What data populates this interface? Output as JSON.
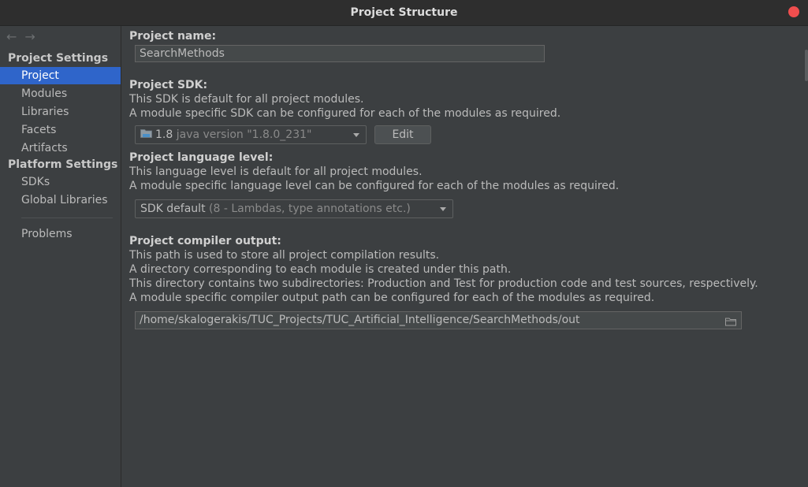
{
  "window": {
    "title": "Project Structure"
  },
  "sidebar": {
    "back_arrow": "←",
    "forward_arrow": "→",
    "group_project_settings": "Project Settings",
    "group_platform_settings": "Platform Settings",
    "items": {
      "project": "Project",
      "modules": "Modules",
      "libraries": "Libraries",
      "facets": "Facets",
      "artifacts": "Artifacts",
      "sdks": "SDKs",
      "global_libraries": "Global Libraries",
      "problems": "Problems"
    }
  },
  "main": {
    "project_name": {
      "label": "Project name:",
      "value": "SearchMethods"
    },
    "project_sdk": {
      "label": "Project SDK:",
      "line1": "This SDK is default for all project modules.",
      "line2": "A module specific SDK can be configured for each of the modules as required.",
      "selected_version": "1.8",
      "selected_detail": "java version \"1.8.0_231\"",
      "edit_label": "Edit"
    },
    "language_level": {
      "label": "Project language level:",
      "line1": "This language level is default for all project modules.",
      "line2": "A module specific language level can be configured for each of the modules as required.",
      "selected": "SDK default",
      "selected_detail": "(8 - Lambdas, type annotations etc.)"
    },
    "compiler_output": {
      "label": "Project compiler output:",
      "line1": "This path is used to store all project compilation results.",
      "line2": "A directory corresponding to each module is created under this path.",
      "line3": "This directory contains two subdirectories: Production and Test for production code and test sources, respectively.",
      "line4": "A module specific compiler output path can be configured for each of the modules as required.",
      "path": "/home/skalogerakis/TUC_Projects/TUC_Artificial_Intelligence/SearchMethods/out"
    }
  },
  "colors": {
    "accent": "#2f65ca",
    "close": "#f04e4e",
    "background": "#3c3f41"
  }
}
